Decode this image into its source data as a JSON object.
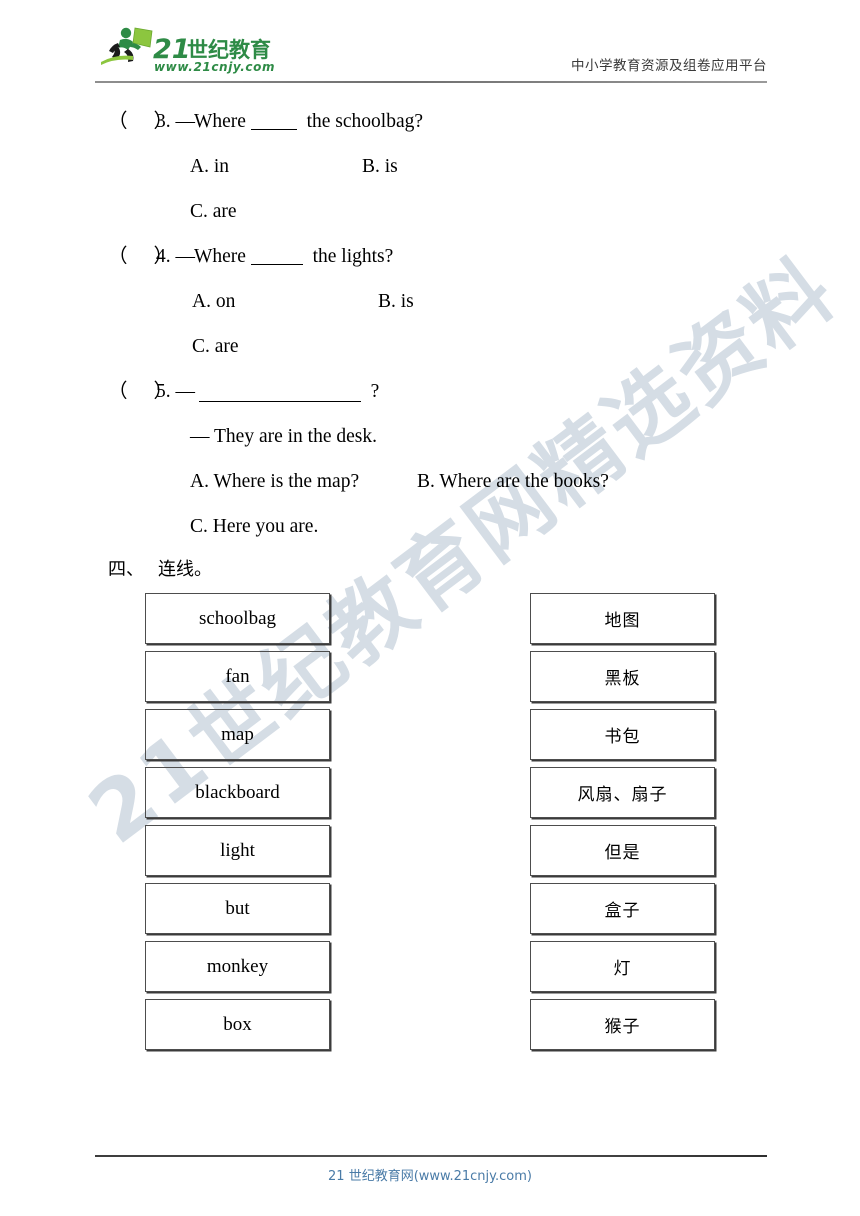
{
  "header": {
    "logo_main": "21世纪教育",
    "logo_url": "www.21cnjy.com",
    "tagline": "中小学教育资源及组卷应用平台",
    "logo_green": "#2e8b46",
    "logo_light_green": "#8cc63f"
  },
  "watermark": {
    "text": "21世纪教育网精选资料",
    "color": "#d5dde5"
  },
  "questions": [
    {
      "marker_open": "（",
      "marker_close": "）",
      "number": "3.",
      "dash": "—",
      "stem_before": "Where",
      "stem_after": "the schoolbag?",
      "options": [
        {
          "label": "A. in"
        },
        {
          "label": "B. is"
        },
        {
          "label": "C. are"
        }
      ]
    },
    {
      "marker_open": "（",
      "marker_close": "）",
      "number": "4.",
      "dash": "—",
      "stem_before": "Where",
      "stem_after": "the lights?",
      "options": [
        {
          "label": "A. on"
        },
        {
          "label": "B. is"
        },
        {
          "label": "C. are"
        }
      ]
    },
    {
      "marker_open": "（",
      "marker_close": "）",
      "number": "5.",
      "dash": "—",
      "stem_after": "?",
      "answer_line": "— They are in the desk.",
      "options": [
        {
          "label": "A. Where is the map?"
        },
        {
          "label": "B. Where are the books?"
        },
        {
          "label": "C. Here you are."
        }
      ]
    }
  ],
  "section_four": {
    "index": "四、",
    "title": "连线。"
  },
  "matching": {
    "left": [
      "schoolbag",
      "fan",
      "map",
      "blackboard",
      "light",
      "but",
      "monkey",
      "box"
    ],
    "right": [
      "地图",
      "黑板",
      "书包",
      "风扇、扇子",
      "但是",
      "盒子",
      "灯",
      "猴子"
    ]
  },
  "footer": {
    "text": "21 世纪教育网(www.21cnjy.com)",
    "color": "#4a7ba7"
  }
}
